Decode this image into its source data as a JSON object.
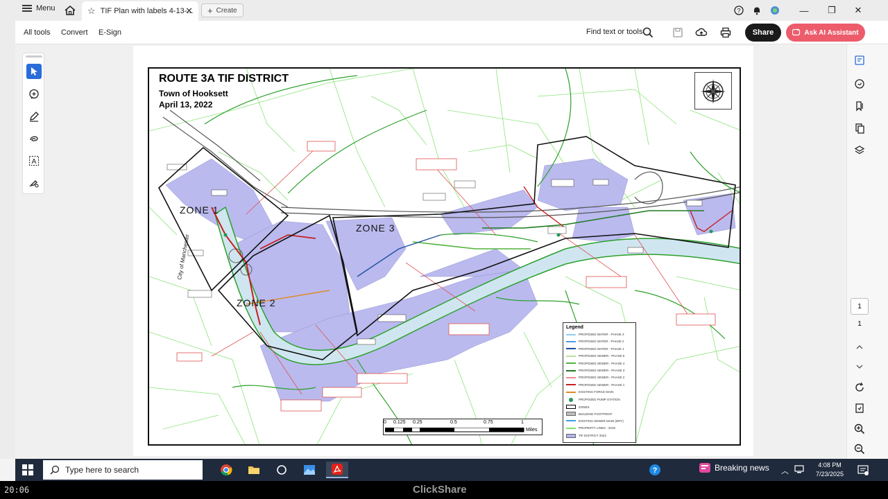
{
  "titlebar": {
    "menu_label": "Menu",
    "tab_title": "TIF Plan with labels 4-13-...",
    "create_label": "Create"
  },
  "toolbar": {
    "all_tools": "All tools",
    "convert": "Convert",
    "esign": "E-Sign",
    "find_text": "Find text or tools",
    "share": "Share",
    "ask_ai": "Ask AI Assistant"
  },
  "map": {
    "title": "ROUTE 3A TIF DISTRICT",
    "subtitle": "Town of Hooksett",
    "date": "April 13, 2022",
    "zones": [
      "ZONE 1",
      "ZONE 2",
      "ZONE 3"
    ],
    "city_label": "City of Manchester",
    "legend": {
      "title": "Legend",
      "items": [
        {
          "label": "PROPOSED WATER - PHASE 3",
          "color": "#8ecbf0"
        },
        {
          "label": "PROPOSED WATER - PHASE 2",
          "color": "#4a9be0"
        },
        {
          "label": "PROPOSED WATER - PHASE 1",
          "color": "#1c4f9c"
        },
        {
          "label": "PROPOSED SEWER - PHASE 5",
          "color": "#b8e0a0"
        },
        {
          "label": "PROPOSED SEWER - PHASE 4",
          "color": "#4fb33a"
        },
        {
          "label": "PROPOSED SEWER - PHASE 3",
          "color": "#1e7a1e"
        },
        {
          "label": "PROPOSED SEWER - PHASE 2",
          "color": "#f08a8a"
        },
        {
          "label": "PROPOSED SEWER - PHASE 1",
          "color": "#c81e1e"
        },
        {
          "label": "EXISTING FORCE MAIN",
          "color": "#e08a2a"
        },
        {
          "label": "PROPOSED PUMP STATION",
          "color": "#1e9a5a"
        },
        {
          "label": "ZONES",
          "color": "#000000"
        },
        {
          "label": "BUILDING FOOTPRINT",
          "color": "#bdbdbd"
        },
        {
          "label": "EXISTING SEWER MAIN (DRY)",
          "color": "#3aa0e0"
        },
        {
          "label": "PROPERTY LINES - 2019",
          "color": "#7ee06a"
        },
        {
          "label": "TIF DISTRICT 2022",
          "color": "#b3b3ee"
        }
      ]
    },
    "scale": {
      "ticks": [
        "0",
        "0.125",
        "0.25",
        "0.5",
        "0.75",
        "1"
      ],
      "units": "Miles"
    }
  },
  "right_rail": {
    "page_current": "1",
    "page_total": "1"
  },
  "taskbar": {
    "search_placeholder": "Type here to search",
    "news": "Breaking news",
    "time": "4:08 PM",
    "date": "7/23/2025"
  },
  "bottom": {
    "clock": "20:06",
    "brand": "ClickShare"
  },
  "colors": {
    "accent_blue": "#2a6cd9",
    "ai_button": "#ec5c6b",
    "tif_district": "#b3b3ee",
    "property_lines": "#7ee06a",
    "river": "#cfe6f0",
    "taskbar": "#1f2a3c"
  }
}
